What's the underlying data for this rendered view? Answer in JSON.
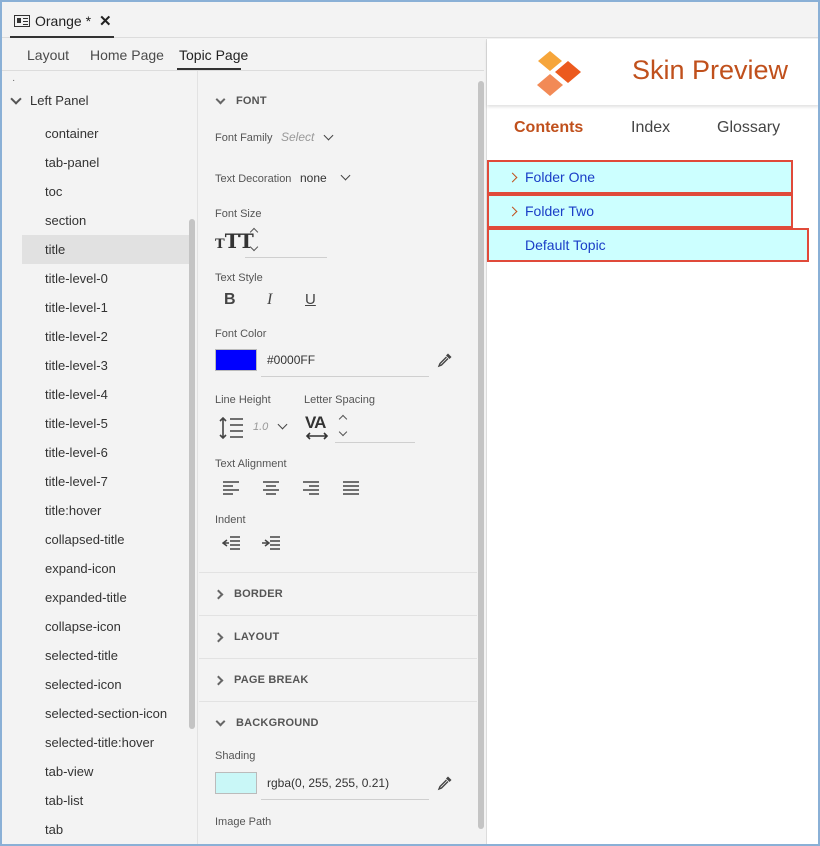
{
  "document_tab": {
    "label": "Orange *",
    "close": "✕"
  },
  "editor_tabs": [
    "Layout",
    "Home Page",
    "Topic Page"
  ],
  "tree": {
    "root": "Left Panel",
    "items": [
      "container",
      "tab-panel",
      "toc",
      "section",
      "title",
      "title-level-0",
      "title-level-1",
      "title-level-2",
      "title-level-3",
      "title-level-4",
      "title-level-5",
      "title-level-6",
      "title-level-7",
      "title:hover",
      "collapsed-title",
      "expand-icon",
      "expanded-title",
      "collapse-icon",
      "selected-title",
      "selected-icon",
      "selected-section-icon",
      "selected-title:hover",
      "tab-view",
      "tab-list",
      "tab"
    ],
    "selected_index": 4
  },
  "font": {
    "header": "FONT",
    "family_label": "Font Family",
    "family_value": "Select",
    "decoration_label": "Text Decoration",
    "decoration_value": "none",
    "size_label": "Font Size",
    "size_icon": "TT",
    "style_label": "Text Style",
    "bold": "B",
    "italic": "I",
    "underline": "U",
    "color_label": "Font Color",
    "color_value": "#0000FF",
    "color_swatch": "#0000FF",
    "line_height_label": "Line Height",
    "line_height_value": "1.0",
    "letter_spacing_label": "Letter Spacing",
    "letter_spacing_icon": "VA",
    "alignment_label": "Text Alignment",
    "indent_label": "Indent"
  },
  "sections": {
    "border": "BORDER",
    "layout": "LAYOUT",
    "page_break": "PAGE BREAK",
    "background": "BACKGROUND"
  },
  "background": {
    "shading_label": "Shading",
    "shading_value": "rgba(0, 255, 255, 0.21)",
    "shading_swatch": "#c9f7f7",
    "image_path_label": "Image Path"
  },
  "preview": {
    "title": "Skin Preview",
    "tabs": [
      "Contents",
      "Index",
      "Glossary"
    ],
    "toc": [
      "Folder One",
      "Folder Two",
      "Default Topic"
    ]
  },
  "colors": {
    "accent": "#c0501c",
    "link": "#1a3ec7",
    "toc_bg": "#ccffff",
    "toc_border": "#e04a3a"
  }
}
